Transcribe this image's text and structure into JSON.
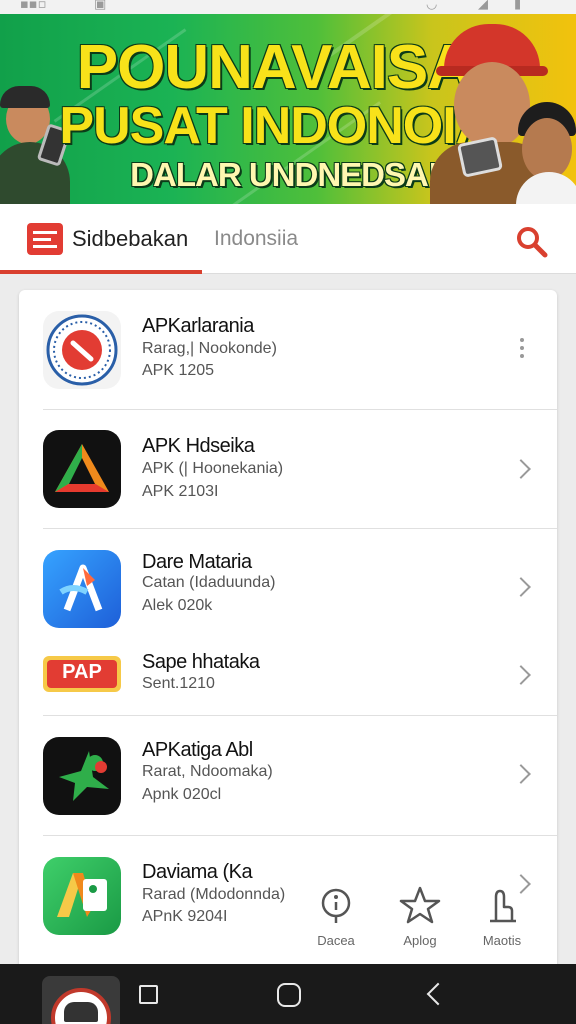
{
  "banner": {
    "line1": "POUNAVAISAI",
    "line2": "PUSAT INDONOIA!",
    "line3": "DALAR UNDNEDSA!"
  },
  "search_bar": {
    "title": "Sidbebakan",
    "query": "Indonsiia"
  },
  "apps": [
    {
      "name": "APKarlarania",
      "line1": "Rarag,| Nookonde)",
      "line2": "APK 1205",
      "action": "more"
    },
    {
      "name": "APK Hdseika",
      "line1": "APK (| Hoonekania)",
      "line2": "APK 2103I",
      "action": "open"
    },
    {
      "name": "Dare Mataria",
      "line1": "Catan (Idaduunda)",
      "line2": "Alek 020k",
      "action": "open"
    },
    {
      "name": "Sape hhataka",
      "line1": "Sent.1210",
      "line2": "",
      "badge": "PAP",
      "action": "open"
    },
    {
      "name": "APKatiga Abl",
      "line1": "Rarat, Ndoomaka)",
      "line2": "Apnk 020cl",
      "action": "open"
    },
    {
      "name": "Daviama (Ka",
      "line1": "Rarad (Mdodonnda)",
      "line2": "APnK 9204I",
      "action": "open"
    }
  ],
  "quick_actions": [
    {
      "label": "Dacea",
      "icon": "info-circle-icon"
    },
    {
      "label": "Aplog",
      "icon": "star-icon"
    },
    {
      "label": "Maotis",
      "icon": "hand-icon"
    }
  ],
  "colors": {
    "accent": "#d9402f",
    "banner_green": "#1bb354",
    "banner_yellow": "#f2c20d",
    "text_yellow": "#f8e21a"
  }
}
